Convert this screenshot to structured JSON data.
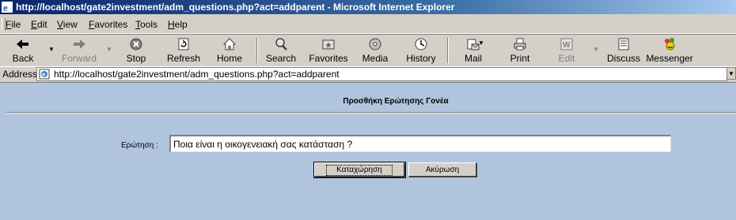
{
  "window": {
    "title": "http://localhost/gate2investment/adm_questions.php?act=addparent - Microsoft Internet Explorer"
  },
  "menu": [
    {
      "u": "F",
      "rest": "ile"
    },
    {
      "u": "E",
      "rest": "dit"
    },
    {
      "u": "V",
      "rest": "iew"
    },
    {
      "u": "F",
      "pre": "",
      "rest": "avorites"
    },
    {
      "u": "T",
      "rest": "ools"
    },
    {
      "u": "H",
      "rest": "elp"
    }
  ],
  "toolbar": {
    "back": "Back",
    "forward": "Forward",
    "stop": "Stop",
    "refresh": "Refresh",
    "home": "Home",
    "search": "Search",
    "favorites": "Favorites",
    "media": "Media",
    "history": "History",
    "mail": "Mail",
    "print": "Print",
    "edit": "Edit",
    "discuss": "Discuss",
    "messenger": "Messenger"
  },
  "address": {
    "label": "Address",
    "url": "http://localhost/gate2investment/adm_questions.php?act=addparent"
  },
  "form": {
    "heading": "Προσθήκη Ερώτησης Γονέα",
    "question_label": "Ερώτηση :",
    "question_value": "Ποια είναι η οικογενειακή σας κατάσταση ?",
    "submit_label": "Καταχώρηση",
    "cancel_label": "Ακύρωση"
  }
}
